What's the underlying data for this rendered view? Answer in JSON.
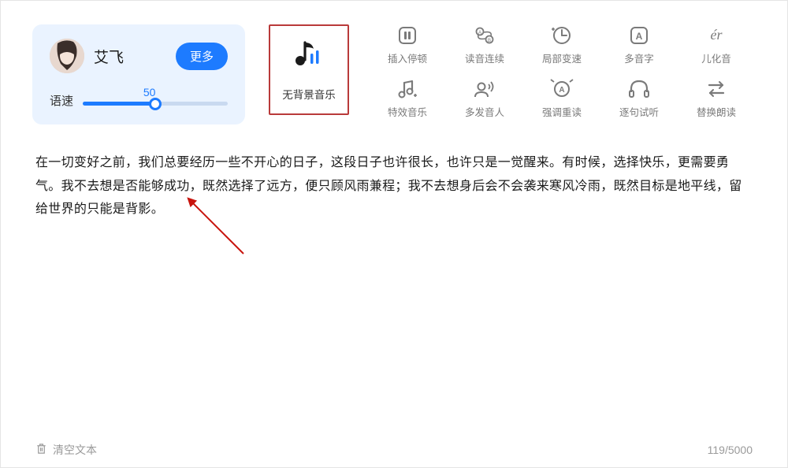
{
  "voice": {
    "name": "艾飞",
    "more_label": "更多",
    "speed_label": "语速",
    "speed_value": "50"
  },
  "bgm": {
    "label": "无背景音乐"
  },
  "tools": {
    "row1": [
      {
        "label": "插入停顿"
      },
      {
        "label": "读音连续"
      },
      {
        "label": "局部变速"
      },
      {
        "label": "多音字"
      },
      {
        "label": "儿化音"
      }
    ],
    "row2": [
      {
        "label": "特效音乐"
      },
      {
        "label": "多发音人"
      },
      {
        "label": "强调重读"
      },
      {
        "label": "逐句试听"
      },
      {
        "label": "替换朗读"
      }
    ]
  },
  "body_text": "在一切变好之前，我们总要经历一些不开心的日子，这段日子也许很长，也许只是一觉醒来。有时候，选择快乐，更需要勇气。我不去想是否能够成功，既然选择了远方，便只顾风雨兼程；我不去想身后会不会袭来寒风冷雨，既然目标是地平线，留给世界的只能是背影。",
  "footer": {
    "clear_label": "清空文本",
    "counter": "119/5000"
  }
}
